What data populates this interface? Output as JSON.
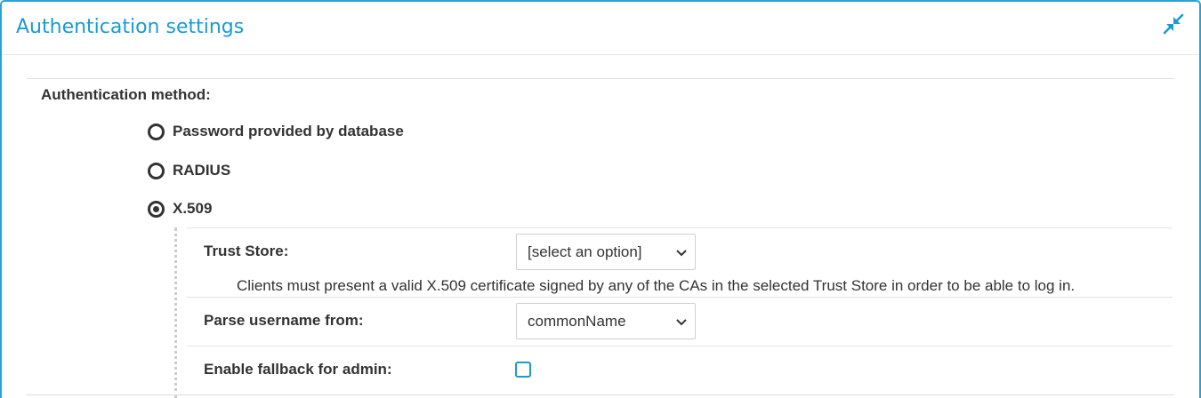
{
  "panel": {
    "title": "Authentication settings",
    "collapse_icon": "collapse-arrows-icon"
  },
  "auth": {
    "method_label": "Authentication method:",
    "options": [
      {
        "label": "Password provided by database",
        "checked": false
      },
      {
        "label": "RADIUS",
        "checked": false
      },
      {
        "label": "X.509",
        "checked": true
      }
    ]
  },
  "x509": {
    "trust_store_label": "Trust Store:",
    "trust_store_value": "[select an option]",
    "help_text": "Clients must present a valid X.509 certificate signed by any of the CAs in the selected Trust Store in order to be able to log in.",
    "parse_username_label": "Parse username from:",
    "parse_username_value": "commonName",
    "fallback_label": "Enable fallback for admin:",
    "fallback_checked": false
  },
  "colors": {
    "accent": "#1b9bd1",
    "border": "#29a3d6",
    "text": "#333333"
  }
}
